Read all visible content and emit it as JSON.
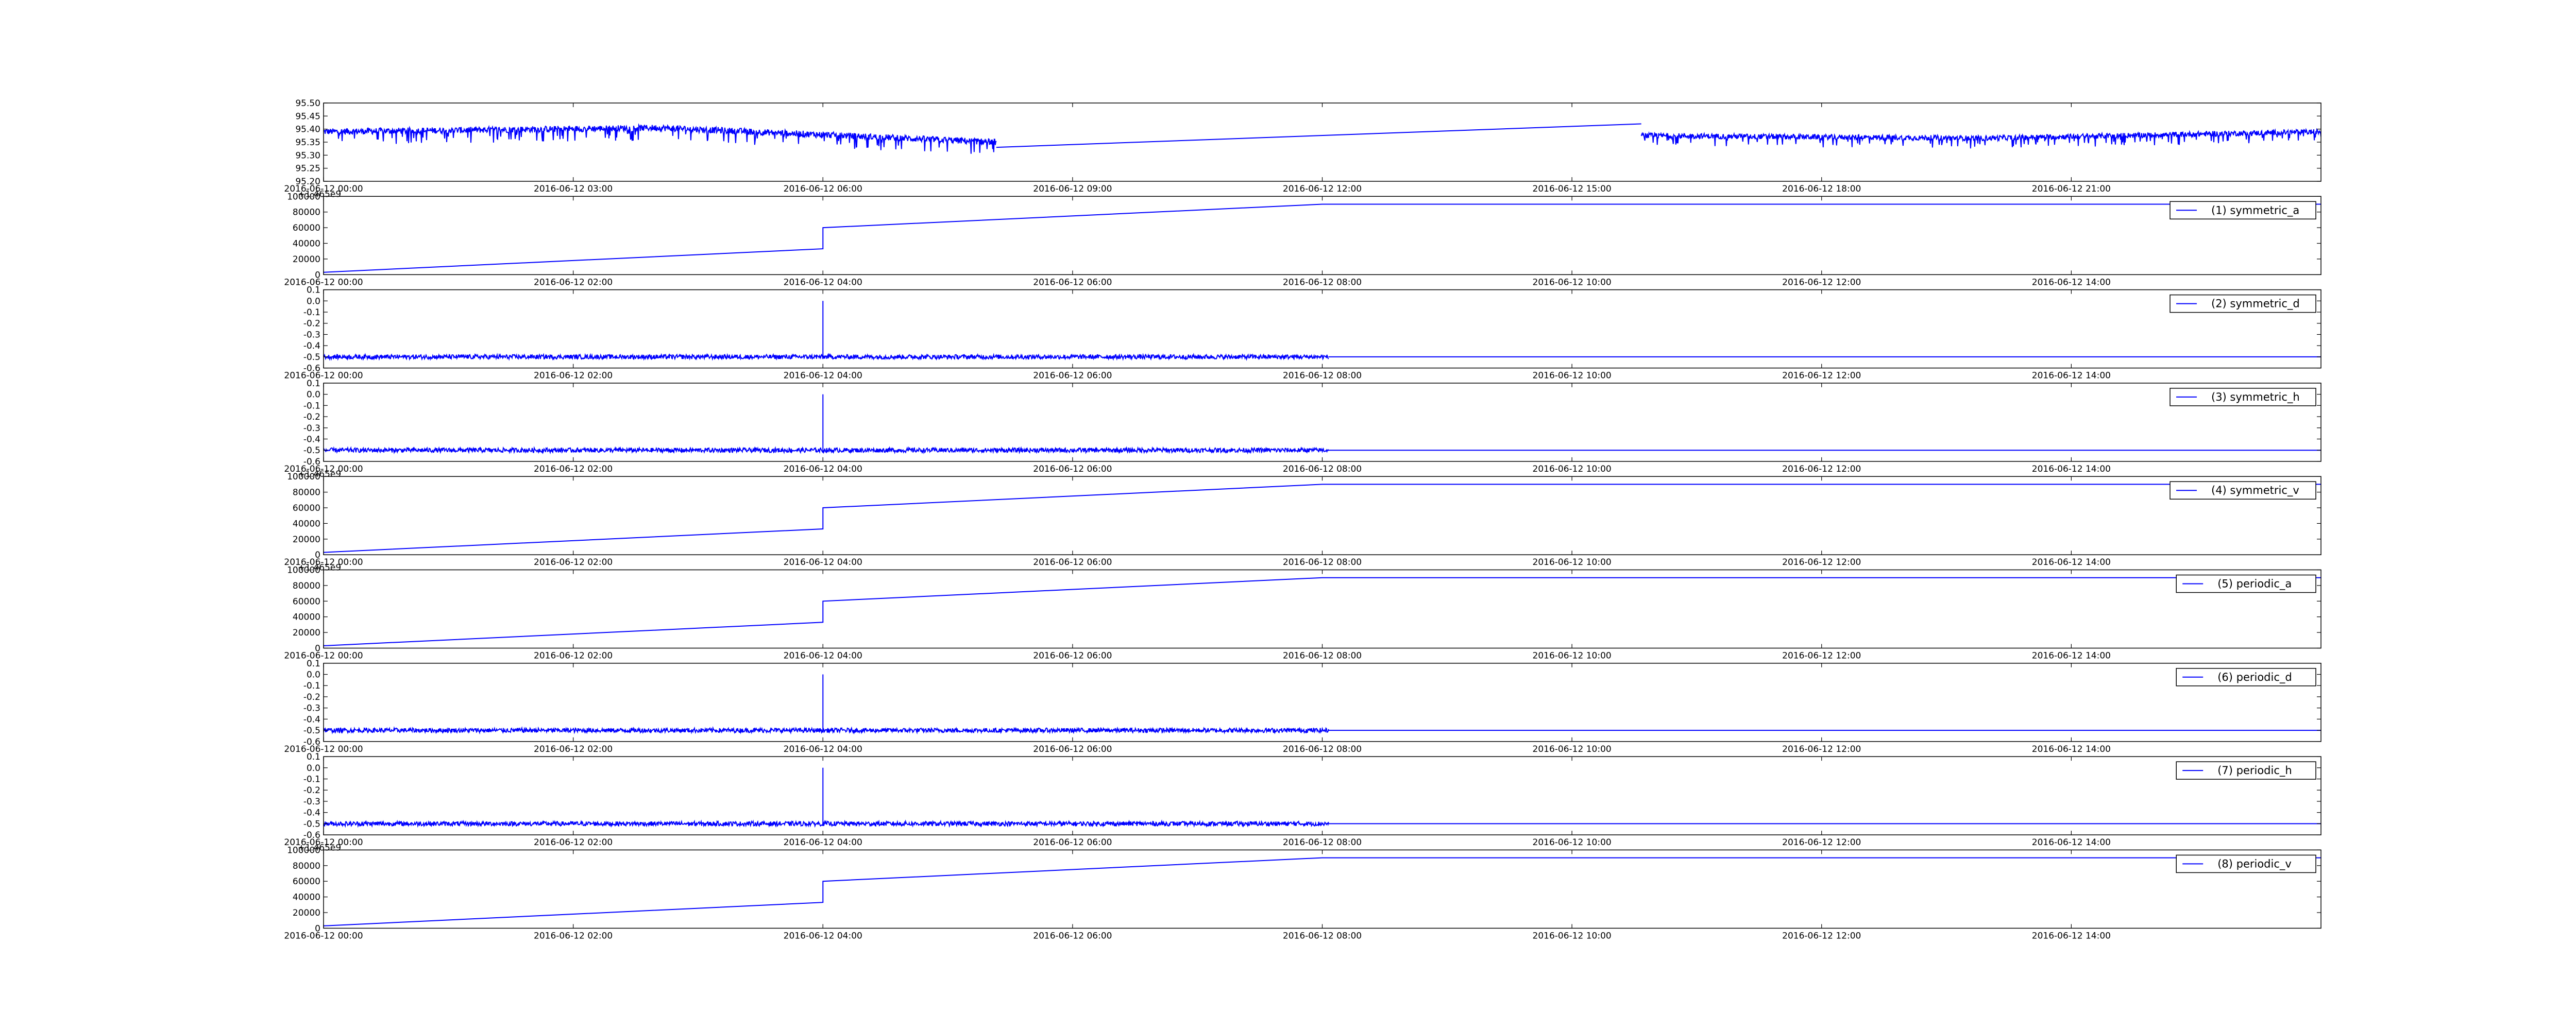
{
  "figure": {
    "line_color": "#0000ff",
    "axes_color": "#000000",
    "background": "#ffffff"
  },
  "chart_data": [
    {
      "type": "line",
      "subplot": 0,
      "legend": "",
      "offset_label": "",
      "yticks": [
        "95.20",
        "95.25",
        "95.30",
        "95.35",
        "95.40",
        "95.45",
        "95.50"
      ],
      "ylim": [
        95.2,
        95.5
      ],
      "xtick_labels": [
        "2016-06-12 00:00",
        "2016-06-12 03:00",
        "2016-06-12 06:00",
        "2016-06-12 09:00",
        "2016-06-12 12:00",
        "2016-06-12 15:00",
        "2016-06-12 18:00",
        "2016-06-12 21:00"
      ],
      "xlim": [
        "2016-06-12 00:00",
        "2016-06-13 00:00"
      ],
      "series": [
        {
          "kind": "noisy_segment",
          "x_start": "2016-06-12 00:00",
          "x_end": "2016-06-12 08:05",
          "y_start": 95.39,
          "y_mid": 95.405,
          "y_end": 95.35,
          "noise": 0.012,
          "dips": 0.05
        },
        {
          "kind": "line",
          "x": [
            "2016-06-12 08:05",
            "2016-06-12 15:50"
          ],
          "y": [
            95.33,
            95.42
          ]
        },
        {
          "kind": "noisy_segment",
          "x_start": "2016-06-12 15:50",
          "x_end": "2016-06-13 00:00",
          "y_start": 95.375,
          "y_mid": 95.365,
          "y_end": 95.39,
          "noise": 0.01,
          "dips": 0.04
        }
      ]
    },
    {
      "type": "line",
      "subplot": 1,
      "legend": "(1) symmetric_a",
      "offset_label": "+1.465e9",
      "yticks": [
        "0",
        "20000",
        "40000",
        "60000",
        "80000",
        "100000"
      ],
      "ylim": [
        0,
        100000
      ],
      "xtick_labels": [
        "2016-06-12 00:00",
        "2016-06-12 02:00",
        "2016-06-12 04:00",
        "2016-06-12 06:00",
        "2016-06-12 08:00",
        "2016-06-12 10:00",
        "2016-06-12 12:00",
        "2016-06-12 14:00"
      ],
      "xlim": [
        "2016-06-12 00:00",
        "2016-06-12 16:00"
      ],
      "series": [
        {
          "kind": "line",
          "x": [
            "2016-06-12 00:00",
            "2016-06-12 04:00",
            "2016-06-12 04:00",
            "2016-06-12 08:00",
            "2016-06-12 16:00"
          ],
          "y": [
            3000,
            33000,
            60000,
            90000,
            90000
          ]
        }
      ]
    },
    {
      "type": "line",
      "subplot": 2,
      "legend": "(2) symmetric_d",
      "offset_label": "",
      "yticks": [
        "-0.6",
        "-0.5",
        "-0.4",
        "-0.3",
        "-0.2",
        "-0.1",
        "0.0",
        "0.1"
      ],
      "ylim": [
        -0.6,
        0.1
      ],
      "xtick_labels": [
        "2016-06-12 00:00",
        "2016-06-12 02:00",
        "2016-06-12 04:00",
        "2016-06-12 06:00",
        "2016-06-12 08:00",
        "2016-06-12 10:00",
        "2016-06-12 12:00",
        "2016-06-12 14:00"
      ],
      "xlim": [
        "2016-06-12 00:00",
        "2016-06-12 16:00"
      ],
      "series": [
        {
          "kind": "noisy_segment",
          "x_start": "2016-06-12 00:00",
          "x_end": "2016-06-12 08:03",
          "y_start": -0.5,
          "y_mid": -0.5,
          "y_end": -0.5,
          "noise": 0.02,
          "dips": 0
        },
        {
          "kind": "line",
          "x": [
            "2016-06-12 04:00",
            "2016-06-12 04:00",
            "2016-06-12 04:00"
          ],
          "y": [
            -0.52,
            0.0,
            -0.52
          ]
        },
        {
          "kind": "line",
          "x": [
            "2016-06-12 08:03",
            "2016-06-12 16:00"
          ],
          "y": [
            -0.5,
            -0.5
          ]
        }
      ]
    },
    {
      "type": "line",
      "subplot": 3,
      "legend": "(3) symmetric_h",
      "offset_label": "",
      "yticks": [
        "-0.6",
        "-0.5",
        "-0.4",
        "-0.3",
        "-0.2",
        "-0.1",
        "0.0",
        "0.1"
      ],
      "ylim": [
        -0.6,
        0.1
      ],
      "xtick_labels": [
        "2016-06-12 00:00",
        "2016-06-12 02:00",
        "2016-06-12 04:00",
        "2016-06-12 06:00",
        "2016-06-12 08:00",
        "2016-06-12 10:00",
        "2016-06-12 12:00",
        "2016-06-12 14:00"
      ],
      "xlim": [
        "2016-06-12 00:00",
        "2016-06-12 16:00"
      ],
      "series": [
        {
          "kind": "noisy_segment",
          "x_start": "2016-06-12 00:00",
          "x_end": "2016-06-12 08:03",
          "y_start": -0.5,
          "y_mid": -0.5,
          "y_end": -0.5,
          "noise": 0.02,
          "dips": 0
        },
        {
          "kind": "line",
          "x": [
            "2016-06-12 04:00",
            "2016-06-12 04:00",
            "2016-06-12 04:00"
          ],
          "y": [
            -0.52,
            0.0,
            -0.52
          ]
        },
        {
          "kind": "line",
          "x": [
            "2016-06-12 08:03",
            "2016-06-12 16:00"
          ],
          "y": [
            -0.5,
            -0.5
          ]
        }
      ]
    },
    {
      "type": "line",
      "subplot": 4,
      "legend": "(4) symmetric_v",
      "offset_label": "+1.465e9",
      "yticks": [
        "0",
        "20000",
        "40000",
        "60000",
        "80000",
        "100000"
      ],
      "ylim": [
        0,
        100000
      ],
      "xtick_labels": [
        "2016-06-12 00:00",
        "2016-06-12 02:00",
        "2016-06-12 04:00",
        "2016-06-12 06:00",
        "2016-06-12 08:00",
        "2016-06-12 10:00",
        "2016-06-12 12:00",
        "2016-06-12 14:00"
      ],
      "xlim": [
        "2016-06-12 00:00",
        "2016-06-12 16:00"
      ],
      "series": [
        {
          "kind": "line",
          "x": [
            "2016-06-12 00:00",
            "2016-06-12 04:00",
            "2016-06-12 04:00",
            "2016-06-12 08:00",
            "2016-06-12 16:00"
          ],
          "y": [
            3000,
            33000,
            60000,
            90000,
            90000
          ]
        }
      ]
    },
    {
      "type": "line",
      "subplot": 5,
      "legend": "(5) periodic_a",
      "offset_label": "+1.465e9",
      "yticks": [
        "0",
        "20000",
        "40000",
        "60000",
        "80000",
        "100000"
      ],
      "ylim": [
        0,
        100000
      ],
      "xtick_labels": [
        "2016-06-12 00:00",
        "2016-06-12 02:00",
        "2016-06-12 04:00",
        "2016-06-12 06:00",
        "2016-06-12 08:00",
        "2016-06-12 10:00",
        "2016-06-12 12:00",
        "2016-06-12 14:00"
      ],
      "xlim": [
        "2016-06-12 00:00",
        "2016-06-12 16:00"
      ],
      "series": [
        {
          "kind": "line",
          "x": [
            "2016-06-12 00:00",
            "2016-06-12 04:00",
            "2016-06-12 04:00",
            "2016-06-12 08:00",
            "2016-06-12 16:00"
          ],
          "y": [
            3000,
            33000,
            60000,
            90000,
            90000
          ]
        }
      ]
    },
    {
      "type": "line",
      "subplot": 6,
      "legend": "(6) periodic_d",
      "offset_label": "",
      "yticks": [
        "-0.6",
        "-0.5",
        "-0.4",
        "-0.3",
        "-0.2",
        "-0.1",
        "0.0",
        "0.1"
      ],
      "ylim": [
        -0.6,
        0.1
      ],
      "xtick_labels": [
        "2016-06-12 00:00",
        "2016-06-12 02:00",
        "2016-06-12 04:00",
        "2016-06-12 06:00",
        "2016-06-12 08:00",
        "2016-06-12 10:00",
        "2016-06-12 12:00",
        "2016-06-12 14:00"
      ],
      "xlim": [
        "2016-06-12 00:00",
        "2016-06-12 16:00"
      ],
      "series": [
        {
          "kind": "noisy_segment",
          "x_start": "2016-06-12 00:00",
          "x_end": "2016-06-12 08:03",
          "y_start": -0.5,
          "y_mid": -0.5,
          "y_end": -0.5,
          "noise": 0.02,
          "dips": 0
        },
        {
          "kind": "line",
          "x": [
            "2016-06-12 04:00",
            "2016-06-12 04:00",
            "2016-06-12 04:00"
          ],
          "y": [
            -0.52,
            0.0,
            -0.52
          ]
        },
        {
          "kind": "line",
          "x": [
            "2016-06-12 08:03",
            "2016-06-12 16:00"
          ],
          "y": [
            -0.5,
            -0.5
          ]
        }
      ]
    },
    {
      "type": "line",
      "subplot": 7,
      "legend": "(7) periodic_h",
      "offset_label": "",
      "yticks": [
        "-0.6",
        "-0.5",
        "-0.4",
        "-0.3",
        "-0.2",
        "-0.1",
        "0.0",
        "0.1"
      ],
      "ylim": [
        -0.6,
        0.1
      ],
      "xtick_labels": [
        "2016-06-12 00:00",
        "2016-06-12 02:00",
        "2016-06-12 04:00",
        "2016-06-12 06:00",
        "2016-06-12 08:00",
        "2016-06-12 10:00",
        "2016-06-12 12:00",
        "2016-06-12 14:00"
      ],
      "xlim": [
        "2016-06-12 00:00",
        "2016-06-12 16:00"
      ],
      "series": [
        {
          "kind": "noisy_segment",
          "x_start": "2016-06-12 00:00",
          "x_end": "2016-06-12 08:03",
          "y_start": -0.5,
          "y_mid": -0.5,
          "y_end": -0.5,
          "noise": 0.02,
          "dips": 0
        },
        {
          "kind": "line",
          "x": [
            "2016-06-12 04:00",
            "2016-06-12 04:00",
            "2016-06-12 04:00"
          ],
          "y": [
            -0.52,
            0.0,
            -0.52
          ]
        },
        {
          "kind": "line",
          "x": [
            "2016-06-12 08:03",
            "2016-06-12 16:00"
          ],
          "y": [
            -0.5,
            -0.5
          ]
        }
      ]
    },
    {
      "type": "line",
      "subplot": 8,
      "legend": "(8) periodic_v",
      "offset_label": "+1.465e9",
      "yticks": [
        "0",
        "20000",
        "40000",
        "60000",
        "80000",
        "100000"
      ],
      "ylim": [
        0,
        100000
      ],
      "xtick_labels": [
        "2016-06-12 00:00",
        "2016-06-12 02:00",
        "2016-06-12 04:00",
        "2016-06-12 06:00",
        "2016-06-12 08:00",
        "2016-06-12 10:00",
        "2016-06-12 12:00",
        "2016-06-12 14:00"
      ],
      "xlim": [
        "2016-06-12 00:00",
        "2016-06-12 16:00"
      ],
      "series": [
        {
          "kind": "line",
          "x": [
            "2016-06-12 00:00",
            "2016-06-12 04:00",
            "2016-06-12 04:00",
            "2016-06-12 08:00",
            "2016-06-12 16:00"
          ],
          "y": [
            3000,
            33000,
            60000,
            90000,
            90000
          ]
        }
      ]
    }
  ]
}
